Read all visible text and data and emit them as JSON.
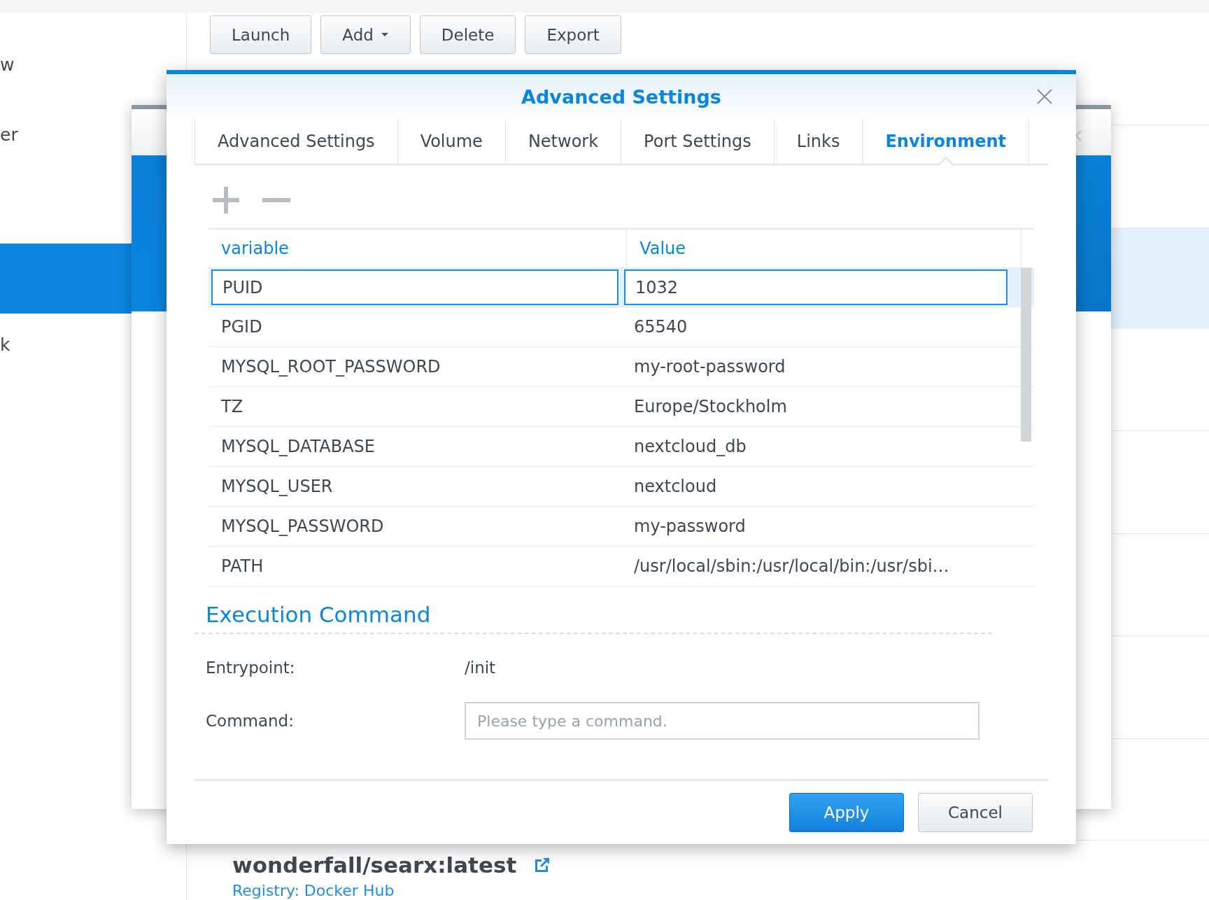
{
  "sidebar": {
    "items": [
      {
        "label": "w",
        "selected": false
      },
      {
        "label": "er",
        "selected": false
      },
      {
        "selected": true
      },
      {
        "label": "k",
        "selected": false
      }
    ]
  },
  "toolbar": {
    "buttons": [
      {
        "label": "Launch",
        "dropdown": false
      },
      {
        "label": "Add",
        "dropdown": true
      },
      {
        "label": "Delete",
        "dropdown": false
      },
      {
        "label": "Export",
        "dropdown": false
      }
    ]
  },
  "dialog": {
    "title": "Advanced Settings",
    "tabs": [
      {
        "label": "Advanced Settings",
        "selected": false
      },
      {
        "label": "Volume",
        "selected": false
      },
      {
        "label": "Network",
        "selected": false
      },
      {
        "label": "Port Settings",
        "selected": false
      },
      {
        "label": "Links",
        "selected": false
      },
      {
        "label": "Environment",
        "selected": true
      }
    ],
    "table": {
      "columns": [
        "variable",
        "Value"
      ],
      "rows": [
        {
          "variable": "PUID",
          "value": "1032",
          "selected": true
        },
        {
          "variable": "PGID",
          "value": "65540",
          "selected": false
        },
        {
          "variable": "MYSQL_ROOT_PASSWORD",
          "value": "my-root-password",
          "selected": false
        },
        {
          "variable": "TZ",
          "value": "Europe/Stockholm",
          "selected": false
        },
        {
          "variable": "MYSQL_DATABASE",
          "value": "nextcloud_db",
          "selected": false
        },
        {
          "variable": "MYSQL_USER",
          "value": "nextcloud",
          "selected": false
        },
        {
          "variable": "MYSQL_PASSWORD",
          "value": "my-password",
          "selected": false
        },
        {
          "variable": "PATH",
          "value": "/usr/local/sbin:/usr/local/bin:/usr/sbi…",
          "selected": false
        }
      ]
    },
    "section_title": "Execution Command",
    "entrypoint": {
      "label": "Entrypoint:",
      "value": "/init"
    },
    "command": {
      "label": "Command:",
      "placeholder": "Please type a command."
    },
    "buttons": [
      {
        "label": "Apply",
        "kind": "primary"
      },
      {
        "label": "Cancel",
        "kind": "secondary"
      }
    ]
  },
  "image": {
    "name": "wonderfall/searx:latest",
    "registry": "Registry: Docker Hub"
  }
}
